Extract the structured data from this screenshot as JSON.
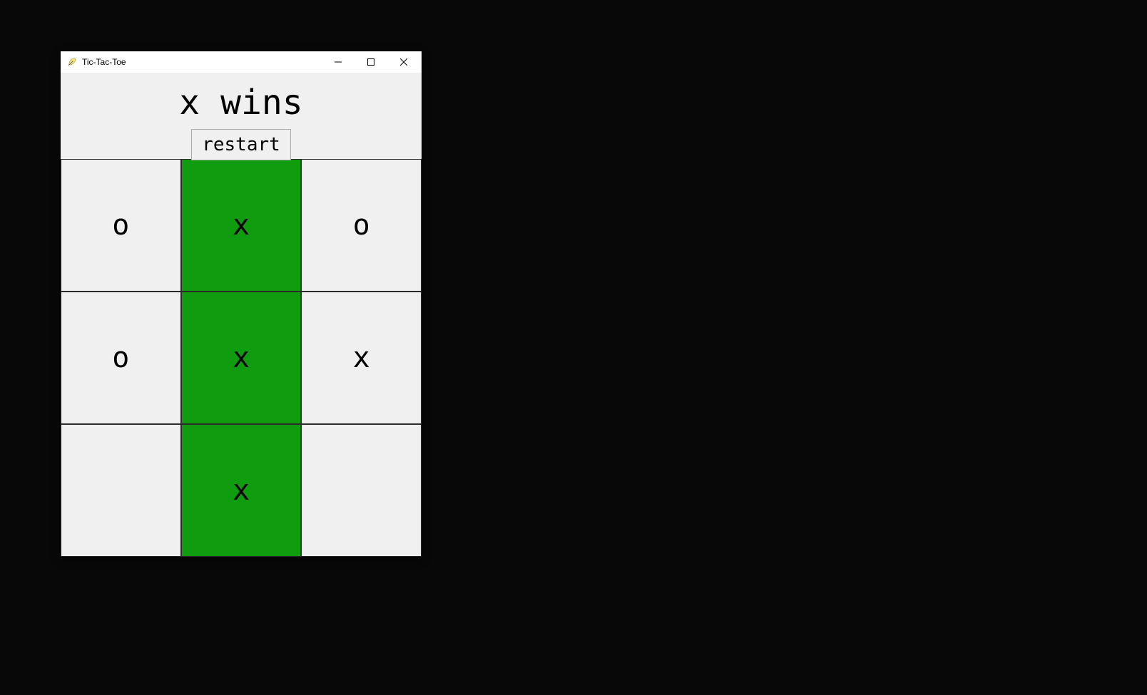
{
  "window": {
    "title": "Tic-Tac-Toe"
  },
  "header": {
    "status_text": "x wins",
    "restart_label": "restart"
  },
  "board": {
    "cells": [
      {
        "value": "o",
        "win": false
      },
      {
        "value": "x",
        "win": true
      },
      {
        "value": "o",
        "win": false
      },
      {
        "value": "o",
        "win": false
      },
      {
        "value": "x",
        "win": true
      },
      {
        "value": "x",
        "win": false
      },
      {
        "value": "",
        "win": false
      },
      {
        "value": "x",
        "win": true
      },
      {
        "value": "",
        "win": false
      }
    ]
  },
  "colors": {
    "win_bg": "#0f9d0f",
    "cell_bg": "#f0f0f0",
    "page_bg": "#080808"
  }
}
